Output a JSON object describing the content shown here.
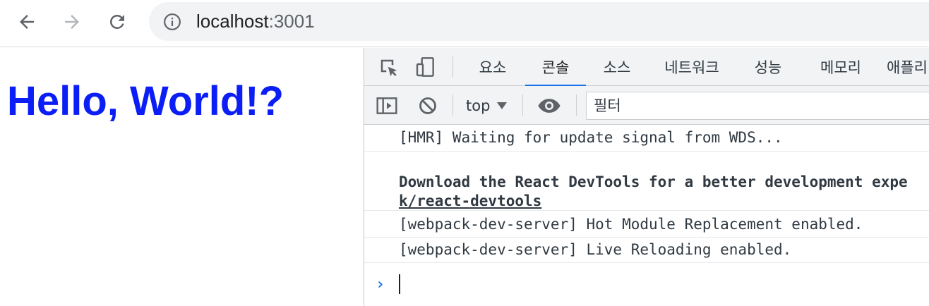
{
  "browser": {
    "url_host": "localhost",
    "url_port": ":3001",
    "icons": {
      "back": "arrow-left-icon",
      "forward": "arrow-right-icon",
      "reload": "reload-icon",
      "info": "info-icon"
    }
  },
  "page": {
    "heading": "Hello, World!?",
    "heading_color": "#0b1ef5"
  },
  "devtools": {
    "tabs": [
      {
        "label": "요소",
        "active": false
      },
      {
        "label": "콘솔",
        "active": true
      },
      {
        "label": "소스",
        "active": false
      },
      {
        "label": "네트워크",
        "active": false
      },
      {
        "label": "성능",
        "active": false
      },
      {
        "label": "메모리",
        "active": false
      },
      {
        "label": "애플리",
        "active": false
      }
    ],
    "context_select": "top",
    "filter_placeholder": "필터",
    "accent_color": "#1a73e8",
    "console": {
      "messages": [
        "[HMR] Waiting for update signal from WDS...",
        "Download the React DevTools for a better development expe",
        "k/react-devtools",
        "[webpack-dev-server] Hot Module Replacement enabled.",
        "[webpack-dev-server] Live Reloading enabled."
      ],
      "prompt_symbol": "›"
    }
  }
}
